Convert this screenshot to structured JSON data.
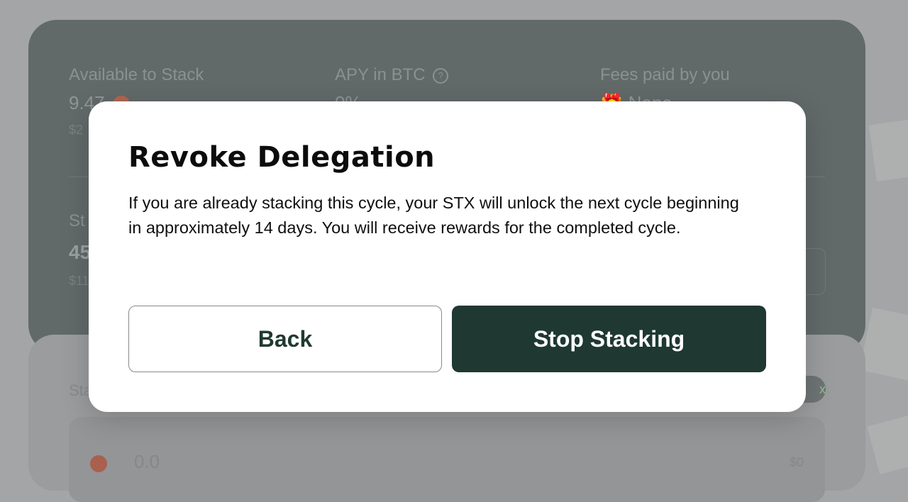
{
  "background": {
    "stats": {
      "available": {
        "label": "Available to Stack",
        "value": "9.47",
        "sub": "$2"
      },
      "apy": {
        "label": "APY in BTC",
        "value": "0%"
      },
      "fees": {
        "label": "Fees paid by you",
        "value": "None"
      },
      "stacked": {
        "label": "St",
        "value": "45",
        "sub": "$11"
      }
    },
    "lower": {
      "label": "Sta",
      "max_label": "x",
      "amount": "0.0",
      "amount_usd": "$0"
    }
  },
  "modal": {
    "title": "Revoke Delegation",
    "body": "If you are already stacking this cycle, your STX will unlock the next cycle beginning in approximately 14 days. You will receive rewards for the completed cycle.",
    "back_label": "Back",
    "stop_label": "Stop Stacking"
  },
  "colors": {
    "primary": "#1f3832",
    "overlay": "#a3a5a6",
    "card": "#626a69"
  },
  "icons": [
    "help-icon",
    "stx-coin-icon",
    "gift-icon"
  ]
}
